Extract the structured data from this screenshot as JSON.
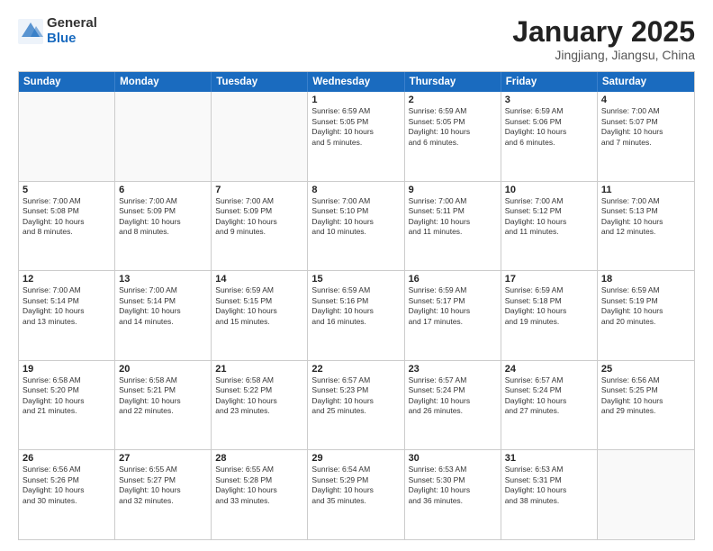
{
  "logo": {
    "general": "General",
    "blue": "Blue"
  },
  "title": {
    "month": "January 2025",
    "location": "Jingjiang, Jiangsu, China"
  },
  "days_header": [
    "Sunday",
    "Monday",
    "Tuesday",
    "Wednesday",
    "Thursday",
    "Friday",
    "Saturday"
  ],
  "weeks": [
    [
      {
        "day": "",
        "info": "",
        "empty": true
      },
      {
        "day": "",
        "info": "",
        "empty": true
      },
      {
        "day": "",
        "info": "",
        "empty": true
      },
      {
        "day": "1",
        "info": "Sunrise: 6:59 AM\nSunset: 5:05 PM\nDaylight: 10 hours\nand 5 minutes."
      },
      {
        "day": "2",
        "info": "Sunrise: 6:59 AM\nSunset: 5:05 PM\nDaylight: 10 hours\nand 6 minutes."
      },
      {
        "day": "3",
        "info": "Sunrise: 6:59 AM\nSunset: 5:06 PM\nDaylight: 10 hours\nand 6 minutes."
      },
      {
        "day": "4",
        "info": "Sunrise: 7:00 AM\nSunset: 5:07 PM\nDaylight: 10 hours\nand 7 minutes."
      }
    ],
    [
      {
        "day": "5",
        "info": "Sunrise: 7:00 AM\nSunset: 5:08 PM\nDaylight: 10 hours\nand 8 minutes."
      },
      {
        "day": "6",
        "info": "Sunrise: 7:00 AM\nSunset: 5:09 PM\nDaylight: 10 hours\nand 8 minutes."
      },
      {
        "day": "7",
        "info": "Sunrise: 7:00 AM\nSunset: 5:09 PM\nDaylight: 10 hours\nand 9 minutes."
      },
      {
        "day": "8",
        "info": "Sunrise: 7:00 AM\nSunset: 5:10 PM\nDaylight: 10 hours\nand 10 minutes."
      },
      {
        "day": "9",
        "info": "Sunrise: 7:00 AM\nSunset: 5:11 PM\nDaylight: 10 hours\nand 11 minutes."
      },
      {
        "day": "10",
        "info": "Sunrise: 7:00 AM\nSunset: 5:12 PM\nDaylight: 10 hours\nand 11 minutes."
      },
      {
        "day": "11",
        "info": "Sunrise: 7:00 AM\nSunset: 5:13 PM\nDaylight: 10 hours\nand 12 minutes."
      }
    ],
    [
      {
        "day": "12",
        "info": "Sunrise: 7:00 AM\nSunset: 5:14 PM\nDaylight: 10 hours\nand 13 minutes."
      },
      {
        "day": "13",
        "info": "Sunrise: 7:00 AM\nSunset: 5:14 PM\nDaylight: 10 hours\nand 14 minutes."
      },
      {
        "day": "14",
        "info": "Sunrise: 6:59 AM\nSunset: 5:15 PM\nDaylight: 10 hours\nand 15 minutes."
      },
      {
        "day": "15",
        "info": "Sunrise: 6:59 AM\nSunset: 5:16 PM\nDaylight: 10 hours\nand 16 minutes."
      },
      {
        "day": "16",
        "info": "Sunrise: 6:59 AM\nSunset: 5:17 PM\nDaylight: 10 hours\nand 17 minutes."
      },
      {
        "day": "17",
        "info": "Sunrise: 6:59 AM\nSunset: 5:18 PM\nDaylight: 10 hours\nand 19 minutes."
      },
      {
        "day": "18",
        "info": "Sunrise: 6:59 AM\nSunset: 5:19 PM\nDaylight: 10 hours\nand 20 minutes."
      }
    ],
    [
      {
        "day": "19",
        "info": "Sunrise: 6:58 AM\nSunset: 5:20 PM\nDaylight: 10 hours\nand 21 minutes."
      },
      {
        "day": "20",
        "info": "Sunrise: 6:58 AM\nSunset: 5:21 PM\nDaylight: 10 hours\nand 22 minutes."
      },
      {
        "day": "21",
        "info": "Sunrise: 6:58 AM\nSunset: 5:22 PM\nDaylight: 10 hours\nand 23 minutes."
      },
      {
        "day": "22",
        "info": "Sunrise: 6:57 AM\nSunset: 5:23 PM\nDaylight: 10 hours\nand 25 minutes."
      },
      {
        "day": "23",
        "info": "Sunrise: 6:57 AM\nSunset: 5:24 PM\nDaylight: 10 hours\nand 26 minutes."
      },
      {
        "day": "24",
        "info": "Sunrise: 6:57 AM\nSunset: 5:24 PM\nDaylight: 10 hours\nand 27 minutes."
      },
      {
        "day": "25",
        "info": "Sunrise: 6:56 AM\nSunset: 5:25 PM\nDaylight: 10 hours\nand 29 minutes."
      }
    ],
    [
      {
        "day": "26",
        "info": "Sunrise: 6:56 AM\nSunset: 5:26 PM\nDaylight: 10 hours\nand 30 minutes."
      },
      {
        "day": "27",
        "info": "Sunrise: 6:55 AM\nSunset: 5:27 PM\nDaylight: 10 hours\nand 32 minutes."
      },
      {
        "day": "28",
        "info": "Sunrise: 6:55 AM\nSunset: 5:28 PM\nDaylight: 10 hours\nand 33 minutes."
      },
      {
        "day": "29",
        "info": "Sunrise: 6:54 AM\nSunset: 5:29 PM\nDaylight: 10 hours\nand 35 minutes."
      },
      {
        "day": "30",
        "info": "Sunrise: 6:53 AM\nSunset: 5:30 PM\nDaylight: 10 hours\nand 36 minutes."
      },
      {
        "day": "31",
        "info": "Sunrise: 6:53 AM\nSunset: 5:31 PM\nDaylight: 10 hours\nand 38 minutes."
      },
      {
        "day": "",
        "info": "",
        "empty": true
      }
    ]
  ]
}
